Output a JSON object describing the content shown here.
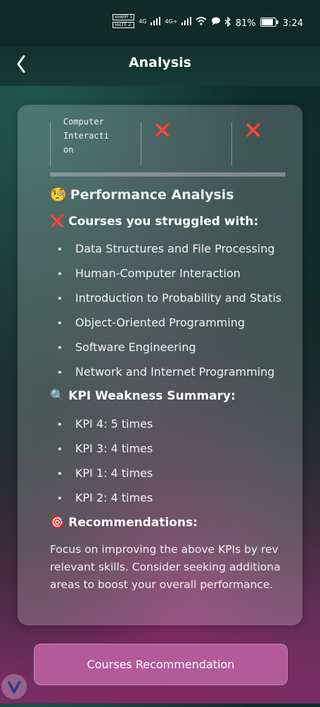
{
  "status_bar": {
    "sim1": "VoWiFi 1",
    "sim2": "VoLTE 2",
    "net1": "4G",
    "net2": "4G+",
    "battery": "81%",
    "time": "3:24"
  },
  "header": {
    "title": "Analysis"
  },
  "table": {
    "course_cell": "Computer\nInteracti\non",
    "mark1": "❌",
    "mark2": "❌"
  },
  "performance": {
    "icon": "🧐",
    "title": "Performance Analysis",
    "struggled_icon": "❌",
    "struggled_title": "Courses you struggled with:",
    "courses": [
      "Data Structures and File Processing",
      "Human-Computer Interaction",
      "Introduction to Probability and Statis",
      "Object-Oriented Programming",
      "Software Engineering",
      "Network and Internet Programming"
    ],
    "kpi_icon": "🔍",
    "kpi_title": "KPI Weakness Summary:",
    "kpis": [
      "KPI 4: 5 times",
      "KPI 3: 4 times",
      "KPI 1: 4 times",
      "KPI 2: 4 times"
    ],
    "rec_icon": "🎯",
    "rec_title": "Recommendations:",
    "rec_lines": [
      "Focus on improving the above KPIs by rev",
      "relevant skills. Consider seeking additiona",
      "areas to boost your overall performance."
    ]
  },
  "button": {
    "label": "Courses Recommendation"
  },
  "colors": {
    "accent": "#b25a9a",
    "x_red": "#e0242c"
  }
}
